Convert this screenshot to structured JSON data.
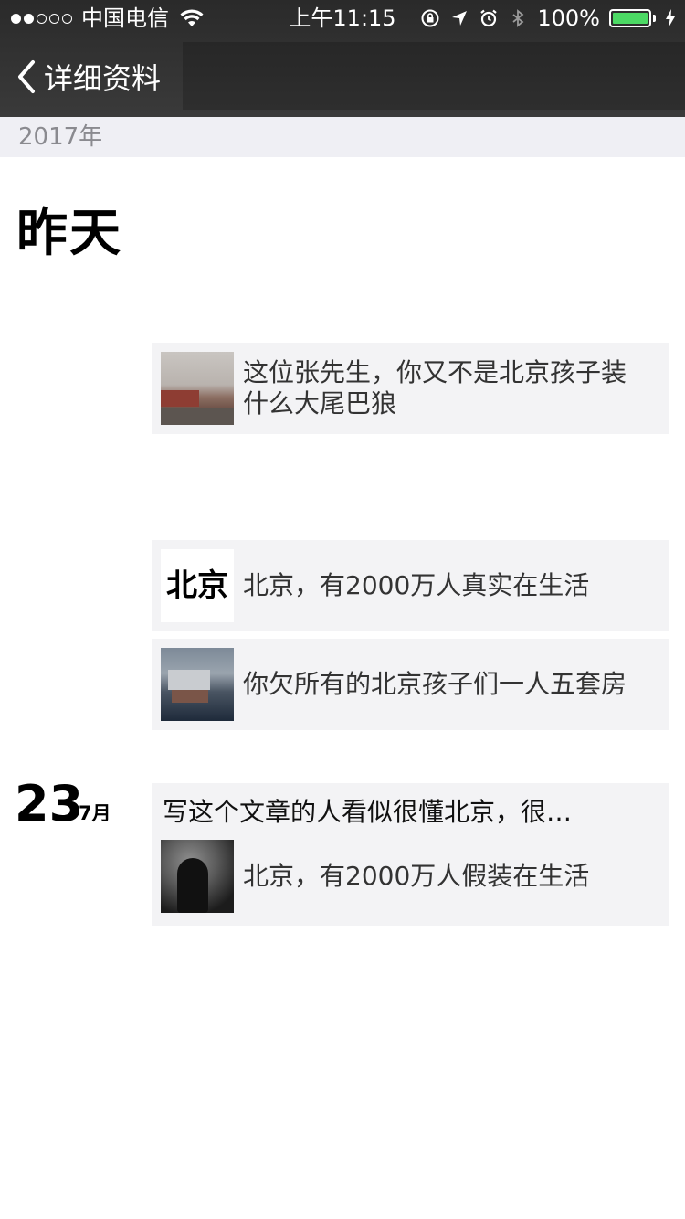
{
  "status_bar": {
    "carrier": "中国电信",
    "time": "上午11:15",
    "battery_percent": "100%",
    "signal_bars_filled": 2,
    "signal_bars_total": 5,
    "battery_level": 1.0
  },
  "nav": {
    "back_label": "详细资料"
  },
  "timeline": {
    "year": "2017年",
    "day_label": "昨天",
    "date": {
      "day": "23",
      "month": "7月"
    }
  },
  "posts": [
    {
      "text": "这位张先生，你又不是北京孩子装什么大尾巴狼"
    },
    {
      "text": "北京，有2000万人真实在生活",
      "thumb_text": "北京"
    },
    {
      "text": "你欠所有的北京孩子们一人五套房"
    },
    {
      "title": "写这个文章的人看似很懂北京，很…",
      "text": "北京，有2000万人假装在生活"
    }
  ],
  "colors": {
    "topbar": "#333333",
    "year_bar": "#efeff4",
    "card_bg": "#f3f3f5",
    "battery_green": "#4cd964"
  }
}
